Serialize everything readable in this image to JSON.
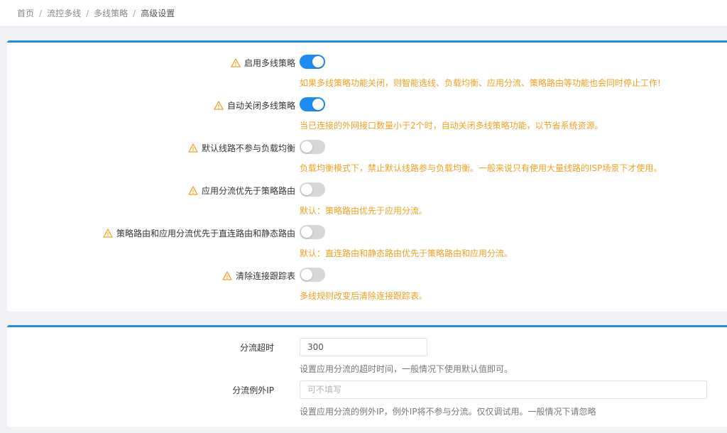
{
  "breadcrumb": {
    "items": [
      "首页",
      "流控多线",
      "多线策略",
      "高级设置"
    ],
    "sep": "/"
  },
  "colors": {
    "accent": "#1e8bf0",
    "warning": "#f0a020",
    "toggle_off": "#d7d7d7"
  },
  "settings": [
    {
      "label": "启用多线策略",
      "enabled": true,
      "hint": "如果多线策略功能关闭，则智能选线、负载均衡、应用分流、策略路由等功能也会同时停止工作!"
    },
    {
      "label": "自动关闭多线策略",
      "enabled": true,
      "hint": "当已连接的外网接口数量小于2个时，自动关闭多线策略功能，以节省系统资源。"
    },
    {
      "label": "默认线路不参与负载均衡",
      "enabled": false,
      "hint": "负载均衡模式下，禁止默认线路参与负载均衡。一般来说只有使用大量线路的ISP场景下才使用。"
    },
    {
      "label": "应用分流优先于策略路由",
      "enabled": false,
      "hint": "默认：策略路由优先于应用分流。"
    },
    {
      "label": "策略路由和应用分流优先于直连路由和静态路由",
      "enabled": false,
      "hint": "默认：直连路由和静态路由优先于策略路由和应用分流。"
    },
    {
      "label": "清除连接跟踪表",
      "enabled": false,
      "hint": "多线规则改变后清除连接跟踪表。"
    }
  ],
  "fields": {
    "timeout": {
      "label": "分流超时",
      "value": "300",
      "hint": "设置应用分流的超时时间，一般情况下使用默认值即可。"
    },
    "exception_ip": {
      "label": "分流例外IP",
      "value": "",
      "placeholder": "可不填写",
      "hint": "设置应用分流的例外IP，例外IP将不参与分流。仅仅调试用。一般情况下请忽略"
    }
  }
}
